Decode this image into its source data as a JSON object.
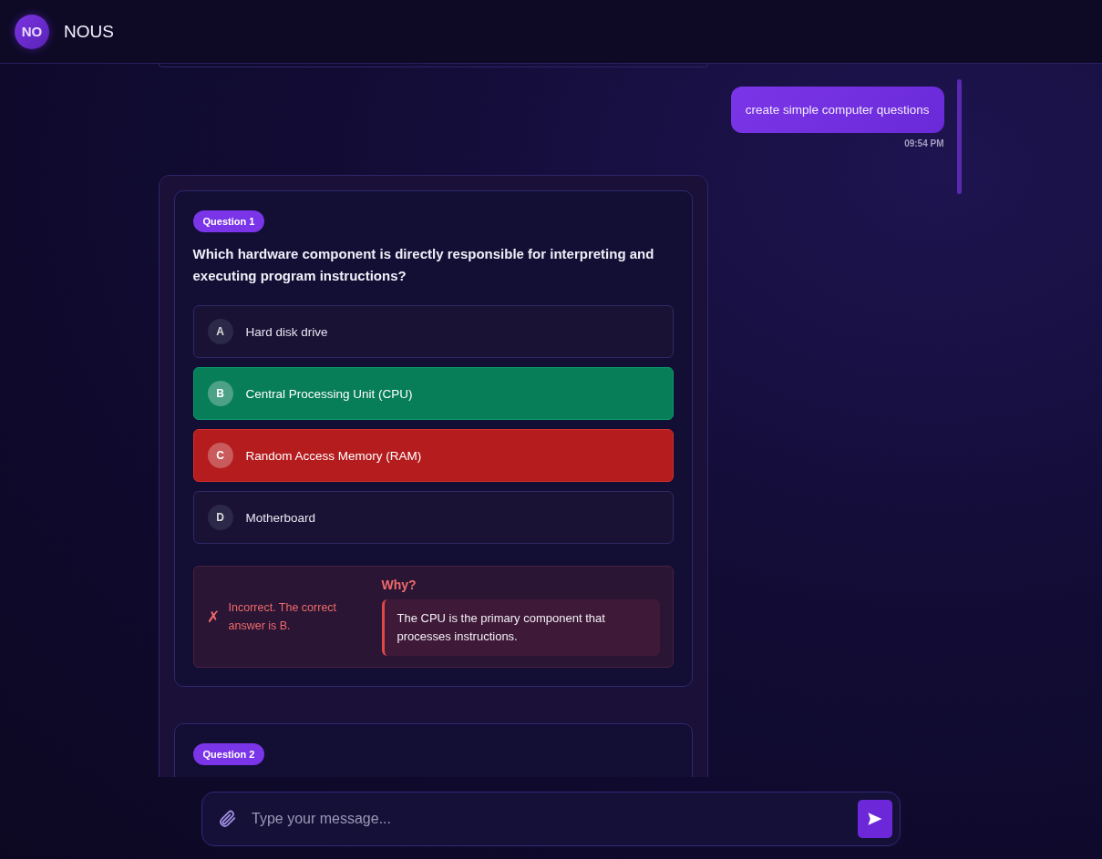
{
  "header": {
    "avatar": "NO",
    "title": "NOUS"
  },
  "user_message": {
    "text": "create simple computer questions",
    "time": "09:54 PM"
  },
  "questions": [
    {
      "badge": "Question 1",
      "text": "Which hardware component is directly responsible for interpreting and executing program instructions?",
      "options": [
        {
          "letter": "A",
          "text": "Hard disk drive",
          "correct": false,
          "wrong_choice": false
        },
        {
          "letter": "B",
          "text": "Central Processing Unit (CPU)",
          "correct": true,
          "wrong_choice": false
        },
        {
          "letter": "C",
          "text": "Random Access Memory (RAM)",
          "correct": false,
          "wrong_choice": true
        },
        {
          "letter": "D",
          "text": "Motherboard",
          "correct": false,
          "wrong_choice": false
        }
      ],
      "feedback": {
        "icon": "✗",
        "result": "Incorrect. The correct answer is B.",
        "why_label": "Why?",
        "explanation": "The CPU is the primary component that processes instructions."
      }
    },
    {
      "badge": "Question 2"
    }
  ],
  "composer": {
    "placeholder": "Type your message..."
  }
}
